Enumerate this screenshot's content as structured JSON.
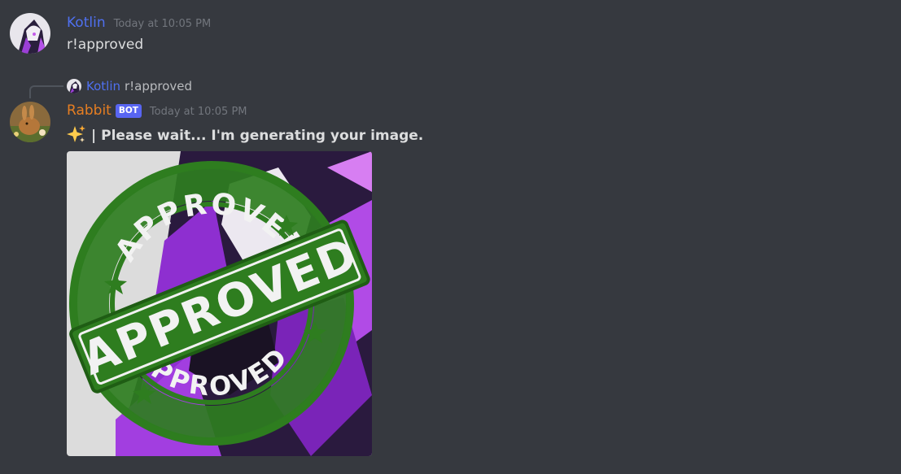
{
  "messages": [
    {
      "username": "Kotlin",
      "timestamp": "Today at 10:05 PM",
      "content": "r!approved"
    },
    {
      "username": "Rabbit",
      "bot_tag": "BOT",
      "timestamp": "Today at 10:05 PM",
      "reply": {
        "username": "Kotlin",
        "content": "r!approved"
      },
      "content_prefix_emoji": "sparkles-icon",
      "content": "| Please wait... I'm generating your image.",
      "attachment": {
        "stamp_text_outer_top": "APPROVED",
        "stamp_text_center": "APPROVED",
        "stamp_text_outer_bottom": "APPROVED"
      }
    }
  ],
  "colors": {
    "background": "#36393f",
    "kotlin_name": "#4f70f0",
    "rabbit_name": "#e67e22",
    "bot_tag": "#5865f2",
    "stamp_green": "#2e7d1f"
  }
}
